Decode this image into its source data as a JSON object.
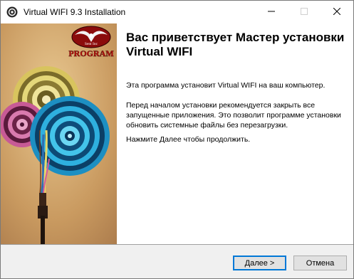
{
  "window": {
    "title": "Virtual WIFI 9.3 Installation"
  },
  "banner": {
    "brand_text": "Sent Inc",
    "program_text": "PROGRAM"
  },
  "content": {
    "heading": "Вас приветствует Мастер установки Virtual WIFI",
    "paragraph_1": "Эта программа установит Virtual WIFI на ваш компьютер.",
    "paragraph_2": "Перед началом установки рекомендуется закрыть все запущенные приложения. Это позволит программе установки обновить системные файлы без перезагрузки.",
    "paragraph_3": "Нажмите Далее чтобы продолжить."
  },
  "buttons": {
    "next_label": "Далее >",
    "cancel_label": "Отмена"
  },
  "icons": {
    "app": "installer-icon",
    "minimize": "minimize-icon",
    "maximize": "maximize-icon",
    "close": "close-icon"
  },
  "colors": {
    "banner_bg": "#c89e6a",
    "accent": "#0078d7"
  }
}
